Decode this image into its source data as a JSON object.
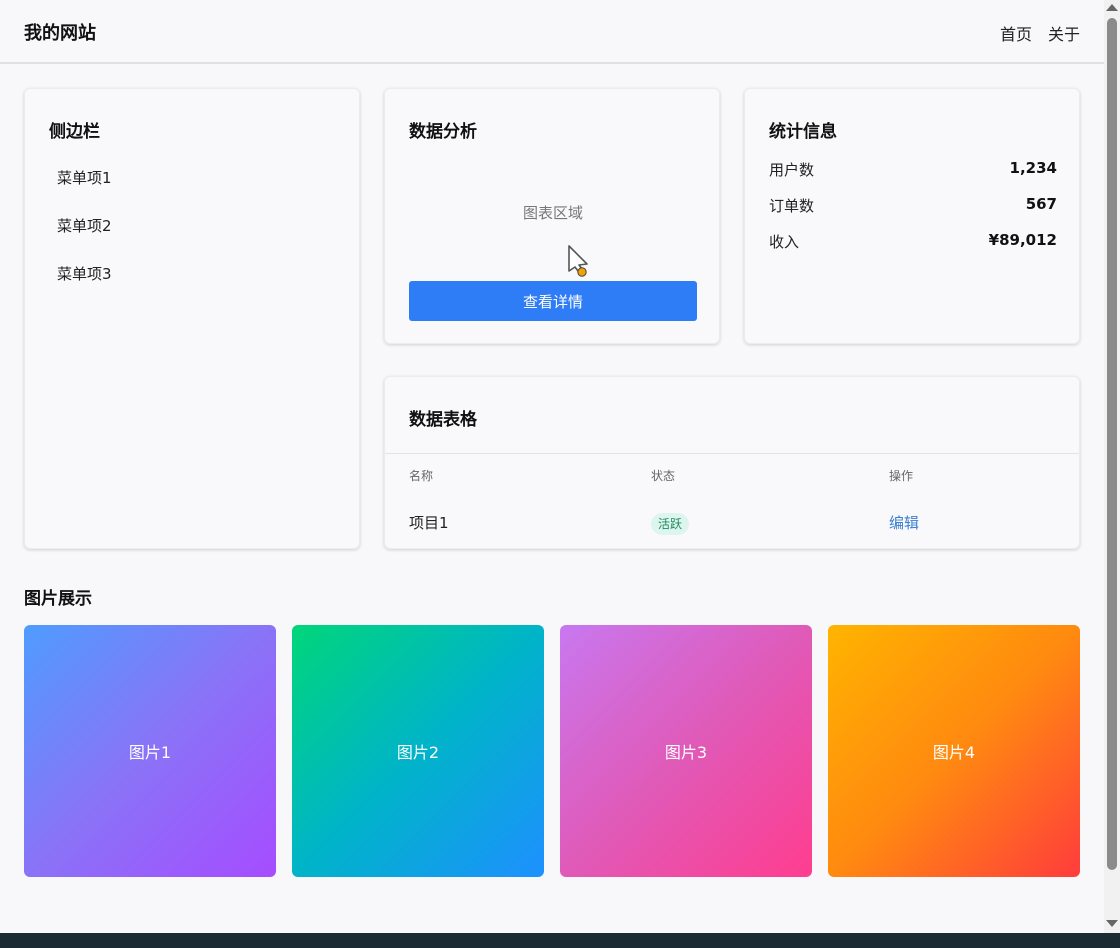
{
  "header": {
    "site_title": "我的网站",
    "nav": [
      "首页",
      "关于"
    ]
  },
  "sidebar": {
    "title": "侧边栏",
    "items": [
      "菜单项1",
      "菜单项2",
      "菜单项3"
    ]
  },
  "analysis": {
    "title": "数据分析",
    "chart_placeholder": "图表区域",
    "button_label": "查看详情"
  },
  "stats": {
    "title": "统计信息",
    "rows": [
      {
        "label": "用户数",
        "value": "1,234"
      },
      {
        "label": "订单数",
        "value": "567"
      },
      {
        "label": "收入",
        "value": "¥89,012"
      }
    ]
  },
  "table": {
    "title": "数据表格",
    "columns": [
      "名称",
      "状态",
      "操作"
    ],
    "rows": [
      {
        "name": "项目1",
        "status": "活跃",
        "action": "编辑"
      }
    ]
  },
  "gallery": {
    "title": "图片展示",
    "items": [
      {
        "label": "图片1",
        "gradient": [
          "#4f9cff",
          "#8a73f7",
          "#a64cff"
        ]
      },
      {
        "label": "图片2",
        "gradient": [
          "#00d67a",
          "#00b4c8",
          "#1e90ff"
        ]
      },
      {
        "label": "图片3",
        "gradient": [
          "#c878f0",
          "#e05ab8",
          "#ff3d8f"
        ]
      },
      {
        "label": "图片4",
        "gradient": [
          "#ffb400",
          "#ff8a10",
          "#ff3c3c"
        ]
      }
    ]
  },
  "colors": {
    "primary": "#2e7cf6",
    "badge_bg": "#ddf5ee",
    "badge_text": "#1e8a5e",
    "link": "#3a7fd0"
  },
  "icons": [
    "pointer-cursor-icon"
  ]
}
